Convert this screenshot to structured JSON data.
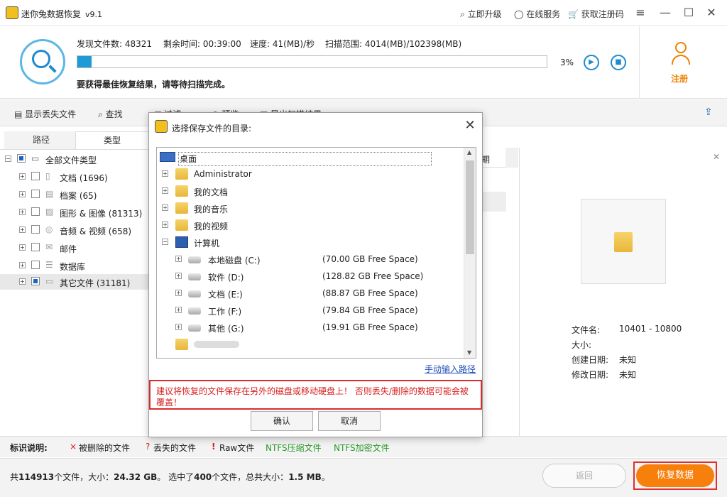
{
  "window": {
    "title": "迷你兔数据恢复",
    "version": "v9.1",
    "upgrade": "立即升级",
    "online_service": "在线服务",
    "get_code": "获取注册码"
  },
  "scan": {
    "found_label": "发现文件数:",
    "found_value": "48321",
    "remaining_label": "剩余时间:",
    "remaining_value": "00:39:00",
    "speed_label": "速度:",
    "speed_value": "41(MB)/秒",
    "range_label": "扫描范围:",
    "range_value": "4014(MB)/102398(MB)",
    "progress_fraction": 0.03,
    "progress_text": "3%",
    "hint": "要获得最佳恢复结果，请等待扫描完成。"
  },
  "register_label": "注册",
  "toolbar": {
    "show_lost": "显示丢失文件",
    "search": "查找",
    "filter": "过滤",
    "preview": "预览",
    "export": "导出扫描结果"
  },
  "left_tabs": [
    "路径",
    "类型"
  ],
  "tree": {
    "root": "全部文件类型",
    "items": [
      {
        "label": "文档 (1696)",
        "icon": "document-icon"
      },
      {
        "label": "档案 (65)",
        "icon": "archive-icon"
      },
      {
        "label": "图形 & 图像 (81313)",
        "icon": "image-icon"
      },
      {
        "label": "音频 & 视频 (658)",
        "icon": "media-icon"
      },
      {
        "label": "邮件",
        "icon": "mail-icon"
      },
      {
        "label": "数据库",
        "icon": "database-icon"
      },
      {
        "label": "其它文件 (31181)",
        "icon": "folder-icon"
      }
    ]
  },
  "mid_header": "期",
  "details": {
    "name_label": "文件名:",
    "name_value": "10401 - 10800",
    "size_label": "大小:",
    "created_label": "创建日期:",
    "created_value": "未知",
    "modified_label": "修改日期:",
    "modified_value": "未知"
  },
  "legend": {
    "title": "标识说明:",
    "deleted": "被删除的文件",
    "lost": "丢失的文件",
    "raw": "Raw文件",
    "ntfs_compressed": "NTFS压缩文件",
    "ntfs_encrypted": "NTFS加密文件"
  },
  "status": {
    "prefix": "共",
    "total_files": "114913",
    "files_mid": "个文件，大小：",
    "total_size": "24.32 GB",
    "selected_mid": "。 选中了",
    "selected_files": "400",
    "selected_suffix": "个文件，总共大小：",
    "selected_size": "1.5 MB",
    "end": "。"
  },
  "buttons": {
    "back": "返回",
    "recover": "恢复数据"
  },
  "dialog": {
    "title": "选择保存文件的目录:",
    "desktop": "桌面",
    "administrator": "Administrator",
    "my_docs": "我的文档",
    "my_music": "我的音乐",
    "my_videos": "我的视频",
    "computer": "计算机",
    "drives": [
      {
        "label": "本地磁盘 (C:)",
        "free": "(70.00 GB Free Space)"
      },
      {
        "label": "软件 (D:)",
        "free": "(128.82 GB Free Space)"
      },
      {
        "label": "文档 (E:)",
        "free": "(88.87 GB Free Space)"
      },
      {
        "label": "工作 (F:)",
        "free": "(79.84 GB Free Space)"
      },
      {
        "label": "其他 (G:)",
        "free": "(19.91 GB Free Space)"
      }
    ],
    "manual_link": "手动输入路径",
    "warning": "建议将恢复的文件保存在另外的磁盘或移动硬盘上！ 否则丢失/删除的数据可能会被覆盖！",
    "confirm": "确认",
    "cancel": "取消"
  },
  "colors": {
    "accent_blue": "#1e9ad6",
    "accent_orange": "#f77f0c",
    "warning_red": "#d81e1e"
  }
}
